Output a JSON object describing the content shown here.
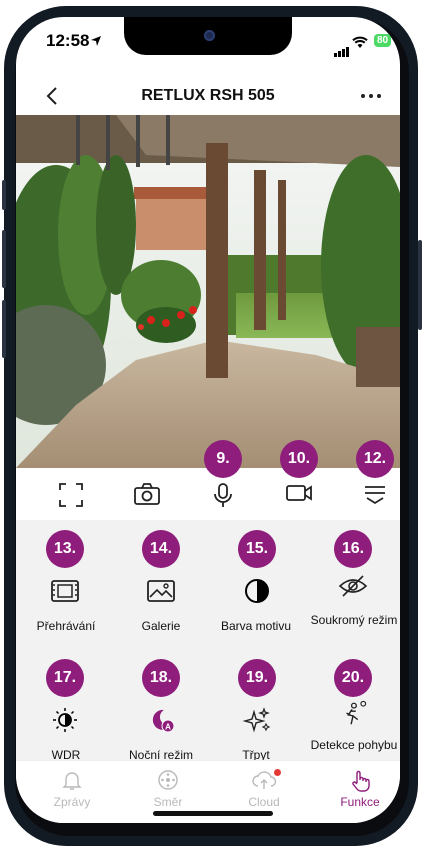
{
  "status_bar": {
    "time": "12:58",
    "battery": "80"
  },
  "nav": {
    "back": "<",
    "title": "RETLUX RSH 505",
    "more": "…"
  },
  "toolbar_badges": {
    "mic": "9.",
    "record": "10.",
    "menu": "12."
  },
  "features": [
    {
      "badge": "13.",
      "label": "Přehrávání"
    },
    {
      "badge": "14.",
      "label": "Galerie"
    },
    {
      "badge": "15.",
      "label": "Barva motivu"
    },
    {
      "badge": "16.",
      "label": "Soukromý režim"
    },
    {
      "badge": "17.",
      "label": "WDR"
    },
    {
      "badge": "18.",
      "label": "Noční režim"
    },
    {
      "badge": "19.",
      "label": "Třpyt"
    },
    {
      "badge": "20.",
      "label": "Detekce pohybu"
    }
  ],
  "tabs": [
    {
      "label": "Zprávy",
      "icon": "bell-icon"
    },
    {
      "label": "Směr",
      "icon": "direction-pad-icon"
    },
    {
      "label": "Cloud",
      "icon": "cloud-upload-icon"
    },
    {
      "label": "Funkce",
      "icon": "tap-hand-icon"
    }
  ],
  "colors": {
    "accent": "#8e1d7c",
    "tab_inactive": "#b9b9b9",
    "notification_dot": "#e53935"
  }
}
